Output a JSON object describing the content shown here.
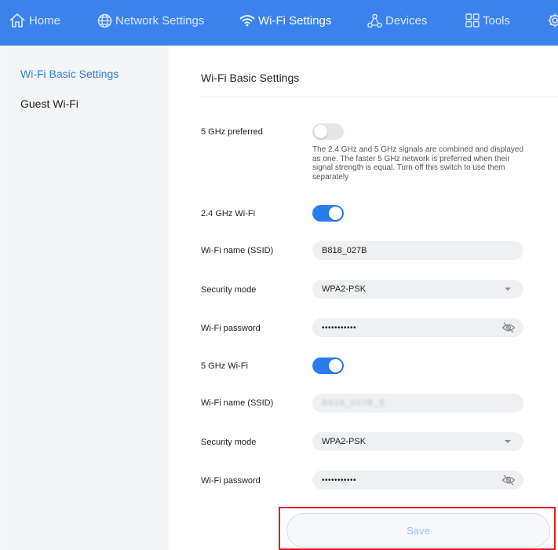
{
  "nav": {
    "items": [
      {
        "label": "Home",
        "icon": "home-icon"
      },
      {
        "label": "Network Settings",
        "icon": "globe-icon"
      },
      {
        "label": "Wi-Fi Settings",
        "icon": "wifi-icon",
        "active": true
      },
      {
        "label": "Devices",
        "icon": "devices-icon"
      },
      {
        "label": "Tools",
        "icon": "tools-icon"
      },
      {
        "label": "",
        "icon": "gear-icon"
      }
    ]
  },
  "sidebar": {
    "items": [
      {
        "label": "Wi-Fi Basic Settings",
        "active": true
      },
      {
        "label": "Guest Wi-Fi",
        "active": false
      }
    ]
  },
  "main": {
    "title": "Wi-Fi Basic Settings",
    "preferred": {
      "label": "5 GHz preferred",
      "enabled": false,
      "note": "The 2.4 GHz and 5 GHz signals are combined and displayed as one. The faster 5 GHz network is preferred when their signal strength is equal. Turn off this switch to use them separately"
    },
    "band24": {
      "label": "2.4 GHz Wi-Fi",
      "enabled": true,
      "ssid_label": "Wi-Fi name (SSID)",
      "ssid": "B818_027B",
      "security_label": "Security mode",
      "security": "WPA2-PSK",
      "password_label": "Wi-Fi password",
      "password_mask": "•••••••••••"
    },
    "band5": {
      "label": "5 GHz Wi-Fi",
      "enabled": true,
      "ssid_label": "Wi-Fi name (SSID)",
      "ssid": "B818_027B_5",
      "security_label": "Security mode",
      "security": "WPA2-PSK",
      "password_label": "Wi-Fi password",
      "password_mask": "•••••••••••"
    },
    "save_label": "Save"
  },
  "colors": {
    "nav_bg": "#3b82ed",
    "accent": "#2a7cec",
    "highlight": "#e11d25"
  }
}
